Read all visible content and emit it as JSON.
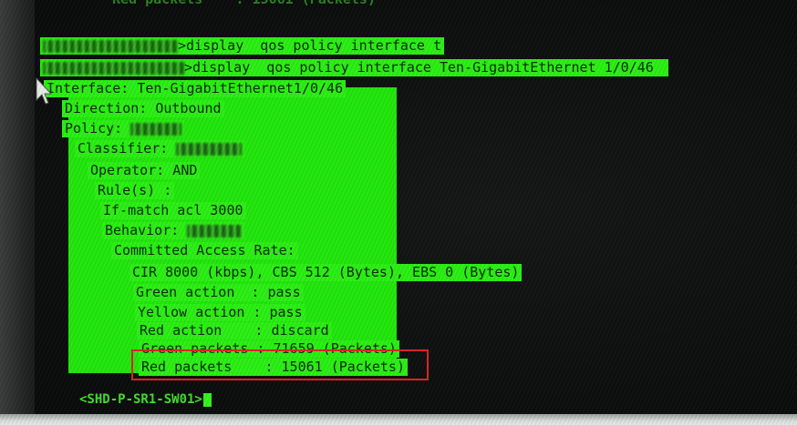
{
  "terminal": {
    "top_partial": "Red packets    : 15061 (Packets)",
    "lines": [
      {
        "before": "",
        "text": ">display  qos policy interface t"
      },
      {
        "before": "",
        "text": ">display  qos policy interface Ten-GigabitEthernet 1/0/46"
      },
      {
        "before": "",
        "text": "Interface: Ten-GigabitEthernet1/0/46"
      },
      {
        "before": "",
        "text": "Direction: Outbound"
      },
      {
        "before": "Policy: ",
        "text": ""
      },
      {
        "before": "Classifier: ",
        "text": ""
      },
      {
        "before": "",
        "text": "Operator: AND"
      },
      {
        "before": "",
        "text": "Rule(s) :"
      },
      {
        "before": "",
        "text": "If-match acl 3000"
      },
      {
        "before": "Behavior: ",
        "text": ""
      },
      {
        "before": "",
        "text": "Committed Access Rate:"
      },
      {
        "before": "",
        "text": "CIR 8000 (kbps), CBS 512 (Bytes), EBS 0 (Bytes)"
      },
      {
        "before": "",
        "text": "Green action  : pass"
      },
      {
        "before": "",
        "text": "Yellow action : pass"
      },
      {
        "before": "",
        "text": "Red action    : discard"
      },
      {
        "before": "",
        "text": "Green packets : 71659 (Packets)"
      },
      {
        "before": "",
        "text": "Red packets    : 15061 (Packets)"
      }
    ],
    "prompt": "<SHD-P-SR1-SW01>"
  },
  "colors": {
    "terminal_green": "#22e80c",
    "highlight_box": "#e0222a"
  },
  "icons": {
    "mouse_pointer": "mouse-pointer-icon"
  }
}
